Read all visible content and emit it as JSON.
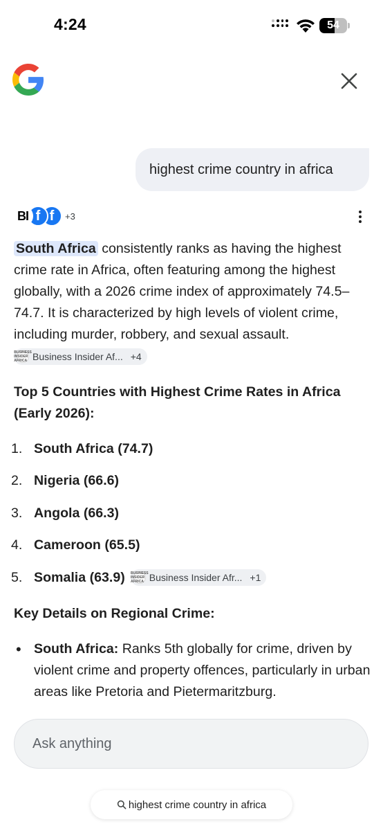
{
  "status_bar": {
    "time": "4:24",
    "battery": "54",
    "battery_level": 0.54
  },
  "header": {
    "logo_icon": "google-g-icon",
    "close_icon": "close-icon"
  },
  "query": "highest crime country in africa",
  "sources": {
    "avatar_labels": [
      "BI",
      "f",
      "f"
    ],
    "more_count": "+3",
    "menu_icon": "more-vert-icon"
  },
  "answer": {
    "highlight": "South Africa",
    "text": " consistently ranks as having the highest crime rate in Africa, often featuring among the highest globally, with a 2026 crime index of approximately 74.5–74.7. It is characterized by high levels of violent crime, including murder, robbery, and sexual assault.",
    "citation": {
      "label": "Business Insider Af...",
      "count": "+4",
      "favicon_text": "BUSINESS INSIDER AFRICA"
    }
  },
  "top5": {
    "heading": "Top 5 Countries with Highest Crime Rates in Africa (Early 2026):",
    "items": [
      {
        "num": "1.",
        "text": "South Africa (74.7)"
      },
      {
        "num": "2.",
        "text": "Nigeria (66.6)"
      },
      {
        "num": "3.",
        "text": "Angola (66.3)"
      },
      {
        "num": "4.",
        "text": "Cameroon (65.5)"
      },
      {
        "num": "5.",
        "text": "Somalia (63.9)"
      }
    ],
    "citation": {
      "label": "Business Insider Afr...",
      "count": "+1",
      "favicon_text": "BUSINESS INSIDER AFRICA"
    }
  },
  "key_details": {
    "heading": "Key Details on Regional Crime:",
    "bullets": [
      {
        "bold": "South Africa:",
        "text": " Ranks 5th globally for crime, driven by violent crime and property offences, particularly in urban areas like Pretoria and Pietermaritzburg."
      }
    ]
  },
  "ask": {
    "placeholder": "Ask anything"
  },
  "search_chip": {
    "label": "highest crime country in africa",
    "icon": "search-icon"
  }
}
